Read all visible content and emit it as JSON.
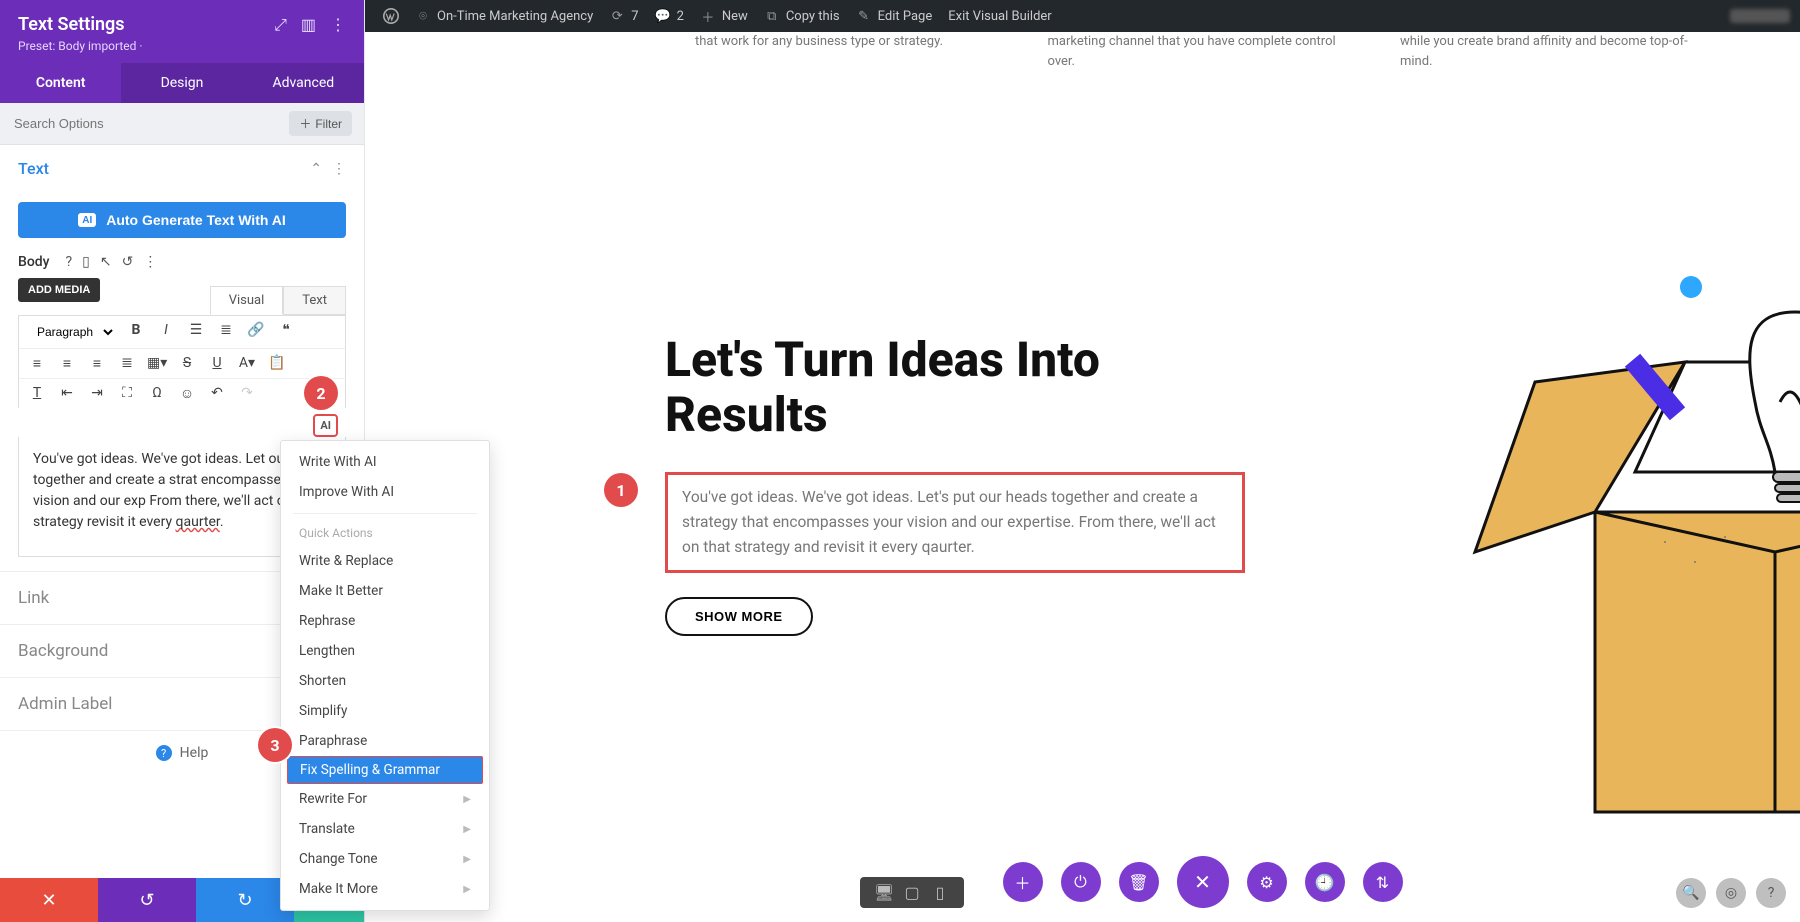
{
  "adminbar": {
    "site": "On-Time Marketing Agency",
    "updates": "7",
    "comments": "2",
    "new": "New",
    "copy": "Copy this",
    "edit": "Edit Page",
    "exit": "Exit Visual Builder"
  },
  "sidebar": {
    "title": "Text Settings",
    "preset": "Preset: Body imported ·",
    "tabs": {
      "content": "Content",
      "design": "Design",
      "advanced": "Advanced"
    },
    "search": "Search Options",
    "filter": "Filter",
    "section": "Text",
    "ai_generate": "Auto Generate Text With AI",
    "body_label": "Body",
    "add_media": "ADD MEDIA",
    "editor_tabs": {
      "visual": "Visual",
      "text": "Text"
    },
    "paragraph": "Paragraph",
    "editor_text_pre": "You've got ideas. We've got ideas. Let our heads together and create a strat encompasses your vision and our exp From there, we'll act on that strategy revisit it every ",
    "editor_typo": "qaurter",
    "editor_dot": ".",
    "link": "Link",
    "background": "Background",
    "admin_label": "Admin Label",
    "help": "Help"
  },
  "ai_menu": {
    "write": "Write With AI",
    "improve": "Improve With AI",
    "quick": "Quick Actions",
    "replace": "Write & Replace",
    "better": "Make It Better",
    "rephrase": "Rephrase",
    "lengthen": "Lengthen",
    "shorten": "Shorten",
    "simplify": "Simplify",
    "paraphrase": "Paraphrase",
    "fix": "Fix Spelling & Grammar",
    "rewrite": "Rewrite For",
    "translate": "Translate",
    "tone": "Change Tone",
    "more": "Make It More"
  },
  "canvas": {
    "card1": "that work for any business type or strategy.",
    "card2": "marketing channel that you have complete control over.",
    "card3": "while you create brand affinity and become top-of-mind.",
    "heading": "Let's Turn Ideas Into Results",
    "paragraph": "You've got ideas. We've got ideas. Let's put our heads together and create a strategy that encompasses your vision and our expertise. From there, we'll act on that strategy and revisit it every qaurter.",
    "show_more": "SHOW MORE",
    "bubbles": {
      "b1": "1",
      "b2": "2",
      "b3": "3"
    }
  }
}
